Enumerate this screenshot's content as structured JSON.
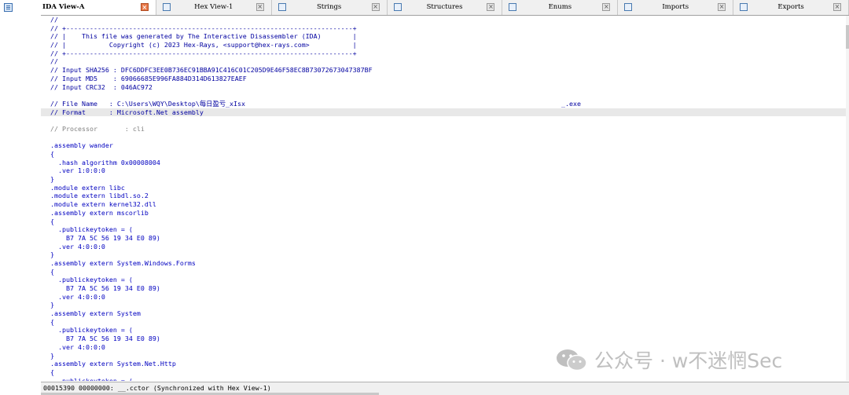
{
  "tabs": [
    {
      "label": "IDA View-A",
      "active": true,
      "icon": "ida-view-icon"
    },
    {
      "label": "Hex View-1",
      "active": false,
      "icon": "hex-view-icon"
    },
    {
      "label": "Strings",
      "active": false,
      "icon": "strings-icon"
    },
    {
      "label": "Structures",
      "active": false,
      "icon": "structures-icon"
    },
    {
      "label": "Enums",
      "active": false,
      "icon": "enums-icon"
    },
    {
      "label": "Imports",
      "active": false,
      "icon": "imports-icon"
    },
    {
      "label": "Exports",
      "active": false,
      "icon": "exports-icon"
    }
  ],
  "code_lines": [
    {
      "text": "//",
      "style": "cmt"
    },
    {
      "text": "// +-------------------------------------------------------------------------+",
      "style": "cmt"
    },
    {
      "text": "// |    This file was generated by The Interactive Disassembler (IDA)        |",
      "style": "cmt"
    },
    {
      "text": "// |           Copyright (c) 2023 Hex-Rays, <support@hex-rays.com>           |",
      "style": "cmt"
    },
    {
      "text": "// +-------------------------------------------------------------------------+",
      "style": "cmt"
    },
    {
      "text": "//",
      "style": "cmt"
    },
    {
      "text": "// Input SHA256 : DFC6DDFC3EE0B736EC91BBA91C416C01C205D9E46F58EC8B73072673047387BF",
      "style": "cmt"
    },
    {
      "text": "// Input MD5    : 69066685E996FA884D314D613827EAEF",
      "style": "cmt"
    },
    {
      "text": "// Input CRC32  : 046AC972",
      "style": "cmt"
    },
    {
      "text": "",
      "style": "blank"
    },
    {
      "text": "// File Name   : C:\\Users\\WQY\\Desktop\\每日盈亏_xIsx",
      "right": "_.exe",
      "style": "cmt"
    },
    {
      "text": "// Format      : Microsoft.Net assembly",
      "style": "cmt hl"
    },
    {
      "text": "",
      "style": "blank"
    },
    {
      "text": "// Processor       : cli",
      "style": "gray"
    },
    {
      "text": "",
      "style": "blank"
    },
    {
      "text": ".assembly wander",
      "style": ""
    },
    {
      "text": "{",
      "style": ""
    },
    {
      "text": "  .hash algorithm 0x00008004",
      "style": ""
    },
    {
      "text": "  .ver 1:0:0:0",
      "style": ""
    },
    {
      "text": "}",
      "style": ""
    },
    {
      "text": ".module extern libc",
      "style": ""
    },
    {
      "text": ".module extern libdl.so.2",
      "style": ""
    },
    {
      "text": ".module extern kernel32.dll",
      "style": ""
    },
    {
      "text": ".assembly extern mscorlib",
      "style": ""
    },
    {
      "text": "{",
      "style": ""
    },
    {
      "text": "  .publickeytoken = (",
      "style": ""
    },
    {
      "text": "    B7 7A 5C 56 19 34 E0 89)",
      "style": ""
    },
    {
      "text": "  .ver 4:0:0:0",
      "style": ""
    },
    {
      "text": "}",
      "style": ""
    },
    {
      "text": ".assembly extern System.Windows.Forms",
      "style": ""
    },
    {
      "text": "{",
      "style": ""
    },
    {
      "text": "  .publickeytoken = (",
      "style": ""
    },
    {
      "text": "    B7 7A 5C 56 19 34 E0 89)",
      "style": ""
    },
    {
      "text": "  .ver 4:0:0:0",
      "style": ""
    },
    {
      "text": "}",
      "style": ""
    },
    {
      "text": ".assembly extern System",
      "style": ""
    },
    {
      "text": "{",
      "style": ""
    },
    {
      "text": "  .publickeytoken = (",
      "style": ""
    },
    {
      "text": "    B7 7A 5C 56 19 34 E0 89)",
      "style": ""
    },
    {
      "text": "  .ver 4:0:0:0",
      "style": ""
    },
    {
      "text": "}",
      "style": ""
    },
    {
      "text": ".assembly extern System.Net.Http",
      "style": ""
    },
    {
      "text": "{",
      "style": ""
    },
    {
      "text": "  .publickeytoken = (",
      "style": ""
    }
  ],
  "status": {
    "text": "00015390 00000000: __.cctor (Synchronized with Hex View-1)"
  },
  "watermark": {
    "text": "公众号 · w不迷惘Sec",
    "color": "#b4b4b4"
  },
  "colors": {
    "code": "#0000c0",
    "highlight": "#e8e8e8",
    "active_close": "#e87a4a"
  }
}
